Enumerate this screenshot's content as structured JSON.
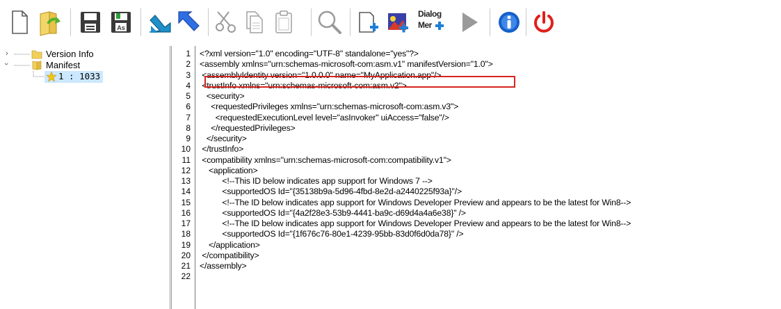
{
  "toolbar": {
    "buttons": [
      {
        "name": "new-file-button",
        "icon": "new-file-icon"
      },
      {
        "name": "open-button",
        "icon": "open-folder-icon"
      },
      {
        "name": "save-button",
        "icon": "save-icon"
      },
      {
        "name": "save-as-button",
        "icon": "save-as-icon",
        "badge": "As"
      },
      {
        "name": "undo-button",
        "icon": "undo-arrow-icon"
      },
      {
        "name": "redo-button",
        "icon": "redo-arrow-icon"
      },
      {
        "name": "cut-button",
        "icon": "scissors-icon"
      },
      {
        "name": "copy-button",
        "icon": "copy-icon"
      },
      {
        "name": "paste-button",
        "icon": "paste-icon"
      },
      {
        "name": "find-button",
        "icon": "magnifier-icon"
      },
      {
        "name": "add-resource-button",
        "icon": "add-resource-icon"
      },
      {
        "name": "add-image-button",
        "icon": "add-image-icon"
      },
      {
        "name": "dialog-merger-button",
        "icon": "dialog-merger-icon",
        "label_line1": "Dialog",
        "label_line2": "Mer"
      },
      {
        "name": "run-button",
        "icon": "play-icon"
      },
      {
        "name": "about-button",
        "icon": "info-icon"
      },
      {
        "name": "exit-button",
        "icon": "power-icon"
      }
    ]
  },
  "tree": {
    "items": [
      {
        "label": "Version Info",
        "expanded": false,
        "icon": "folder-icon"
      },
      {
        "label": "Manifest",
        "expanded": true,
        "icon": "folder-icon"
      },
      {
        "label": "1 : 1033",
        "icon": "star-icon",
        "selected": true
      }
    ]
  },
  "editor": {
    "highlighted_line": 3,
    "line_numbers": [
      "1",
      "2",
      "3",
      "4",
      "5",
      "6",
      "7",
      "8",
      "9",
      "10",
      "11",
      "12",
      "13",
      "14",
      "15",
      "16",
      "17",
      "18",
      "19",
      "20",
      "21",
      "22"
    ],
    "lines": [
      "<?xml version=\"1.0\" encoding=\"UTF-8\" standalone=\"yes\"?>",
      "<assembly xmlns=\"urn:schemas-microsoft-com:asm.v1\" manifestVersion=\"1.0\">",
      " <assemblyIdentity version=\"1.0.0.0\" name=\"MyApplication.app\"/>",
      " <trustInfo xmlns=\"urn:schemas-microsoft-com:asm.v2\">",
      "   <security>",
      "     <requestedPrivileges xmlns=\"urn:schemas-microsoft-com:asm.v3\">",
      "       <requestedExecutionLevel level=\"asInvoker\" uiAccess=\"false\"/>",
      "     </requestedPrivileges>",
      "   </security>",
      " </trustInfo>",
      " <compatibility xmlns=\"urn:schemas-microsoft-com:compatibility.v1\">",
      "    <application>",
      "          <!--This ID below indicates app support for Windows 7 -->",
      "          <supportedOS Id=\"{35138b9a-5d96-4fbd-8e2d-a2440225f93a}\"/>",
      "          <!--The ID below indicates app support for Windows Developer Preview and appears to be the latest for Win8-->",
      "          <supportedOS Id=\"{4a2f28e3-53b9-4441-ba9c-d69d4a4a6e38}\" />",
      "          <!--The ID below indicates app support for Windows Developer Preview and appears to be the latest for Win8-->",
      "          <supportedOS Id=\"{1f676c76-80e1-4239-95bb-83d0f6d0da78}\" />",
      "    </application>",
      " </compatibility>",
      "</assembly>",
      ""
    ]
  },
  "colors": {
    "highlight_border": "#d7241f",
    "arrow_blue": "#2f6fe4",
    "arrow_teal": "#1e8fc8",
    "power_red": "#e0201b",
    "info_blue": "#1560c9",
    "save_green": "#2f9d3a"
  }
}
